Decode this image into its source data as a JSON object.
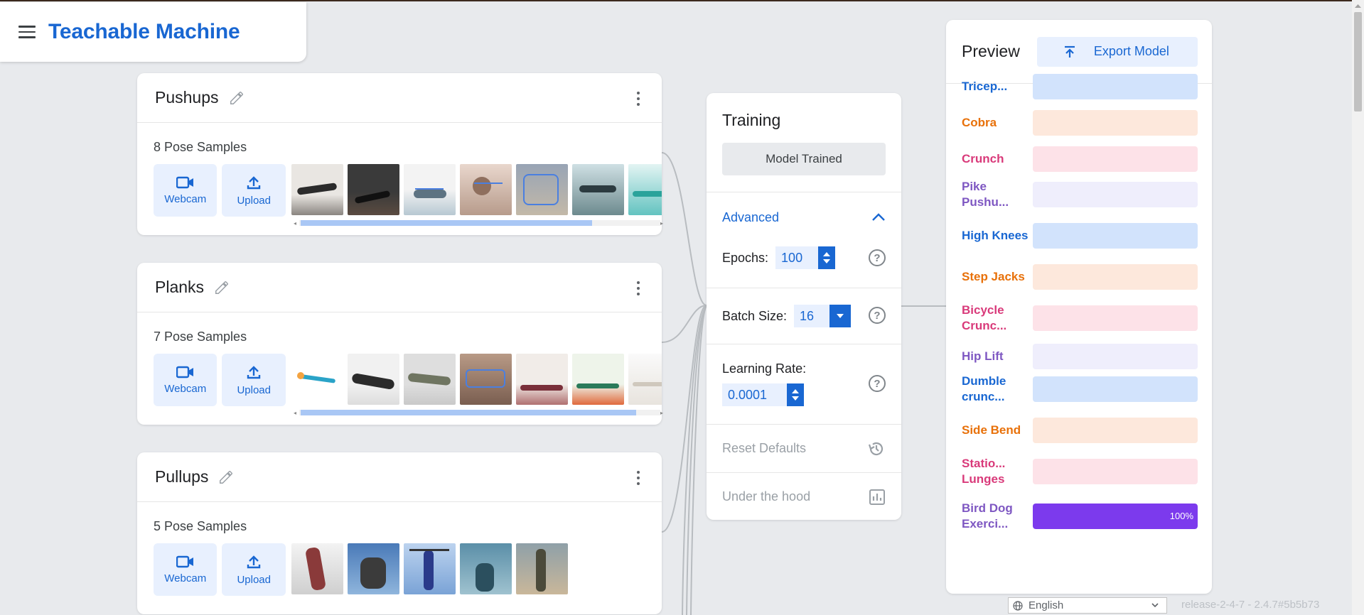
{
  "app": {
    "brand": "Teachable Machine"
  },
  "classes": [
    {
      "name": "Pushups",
      "samples": "8 Pose Samples",
      "webcam": "Webcam",
      "upload": "Upload",
      "thumb_count": 7
    },
    {
      "name": "Planks",
      "samples": "7 Pose Samples",
      "webcam": "Webcam",
      "upload": "Upload",
      "thumb_count": 7
    },
    {
      "name": "Pullups",
      "samples": "5 Pose Samples",
      "webcam": "Webcam",
      "upload": "Upload",
      "thumb_count": 5
    }
  ],
  "training": {
    "title": "Training",
    "status_button": "Model Trained",
    "advanced_label": "Advanced",
    "epochs_label": "Epochs:",
    "epochs_value": "100",
    "batch_label": "Batch Size:",
    "batch_value": "16",
    "lr_label": "Learning Rate:",
    "lr_value": "0.0001",
    "reset_label": "Reset Defaults",
    "hood_label": "Under the hood",
    "help_glyph": "?"
  },
  "preview": {
    "title": "Preview",
    "export_label": "Export Model",
    "items": [
      {
        "label": "Tricep...",
        "color": "#1967d2",
        "bg": "#d2e3fc",
        "value": 0
      },
      {
        "label": "Cobra",
        "color": "#e8710a",
        "bg": "#fde8dc",
        "value": 0
      },
      {
        "label": "Crunch",
        "color": "#d93a7a",
        "bg": "#fde2e8",
        "value": 0
      },
      {
        "label": "Pike Pushu...",
        "color": "#7e57c2",
        "bg": "#efeefc",
        "value": 0
      },
      {
        "label": "High Knees",
        "color": "#1967d2",
        "bg": "#d2e3fc",
        "value": 0
      },
      {
        "label": "Step Jacks",
        "color": "#e8710a",
        "bg": "#fde8dc",
        "value": 0
      },
      {
        "label": "Bicycle Crunc...",
        "color": "#d93a7a",
        "bg": "#fde2e8",
        "value": 0
      },
      {
        "label": "Hip Lift",
        "color": "#7e57c2",
        "bg": "#efeefc",
        "value": 0
      },
      {
        "label": "Dumble crunc...",
        "color": "#1967d2",
        "bg": "#d2e3fc",
        "value": 0
      },
      {
        "label": "Side Bend",
        "color": "#e8710a",
        "bg": "#fde8dc",
        "value": 0
      },
      {
        "label": "Statio... Lunges",
        "color": "#d93a7a",
        "bg": "#fde2e8",
        "value": 0
      },
      {
        "label": "Bird Dog Exerci...",
        "color": "#7e57c2",
        "bg": "#efeefc",
        "value": 1.0,
        "fill": "#7c3aed",
        "pct": "100%"
      }
    ]
  },
  "footer": {
    "language": "English",
    "release": "release-2-4-7 - 2.4.7#5b5b73"
  }
}
